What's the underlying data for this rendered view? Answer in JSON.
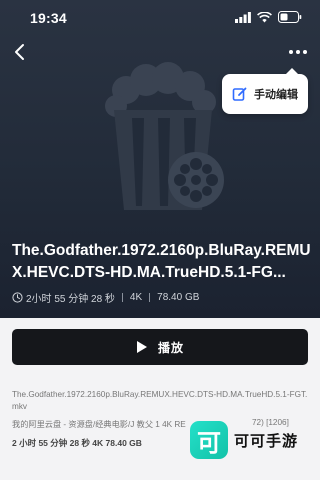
{
  "status_bar": {
    "time": "19:34"
  },
  "menu": {
    "edit_label": "手动编辑"
  },
  "movie": {
    "title": "The.Godfather.1972.2160p.BluRay.REMUX.HEVC.DTS-HD.MA.TrueHD.5.1-FG...",
    "duration": "2小时 55 分钟 28 秒",
    "resolution": "4K",
    "size": "78.40 GB"
  },
  "actions": {
    "play_label": "播放"
  },
  "file": {
    "name": "The.Godfather.1972.2160p.BluRay.REMUX.HEVC.DTS-HD.MA.TrueHD.5.1-FGT.mkv",
    "path": "我的阿里云盘 - 资源盘/经典电影/J 教父 1 4K RE",
    "path_tail": "72) [1206]",
    "stats": "2 小时 55 分钟 28 秒 4K 78.40 GB"
  },
  "watermark": {
    "logo_char": "可",
    "text": "可可手游"
  },
  "colors": {
    "hero_bg": "#222b39",
    "accent": "#2f6bff",
    "brand": "#1fd4b9"
  }
}
